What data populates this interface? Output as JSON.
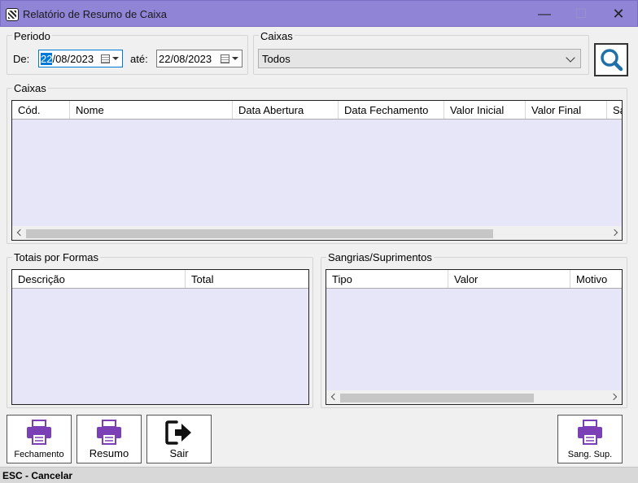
{
  "window": {
    "title": "Relatório de Resumo de Caixa",
    "minimize": "—",
    "maximize": "☐",
    "close": "✕"
  },
  "period": {
    "legend": "Periodo",
    "from_label": "De:",
    "from_value_selected": "22",
    "from_value_rest": "/08/2023",
    "to_label": "até:",
    "to_value": "22/08/2023"
  },
  "caixas_filter": {
    "legend": "Caixas",
    "selected": "Todos"
  },
  "caixas_grid": {
    "legend": "Caixas",
    "columns": [
      "Cód.",
      "Nome",
      "Data Abertura",
      "Data Fechamento",
      "Valor Inicial",
      "Valor Final",
      "Sa"
    ],
    "rows": []
  },
  "totais_grid": {
    "legend": "Totais por Formas",
    "columns": [
      "Descrição",
      "Total"
    ],
    "rows": []
  },
  "sangrias_grid": {
    "legend": "Sangrias/Suprimentos",
    "columns": [
      "Tipo",
      "Valor",
      "Motivo"
    ],
    "rows": []
  },
  "buttons": {
    "fechamento": "Fechamento",
    "resumo": "Resumo",
    "sair": "Sair",
    "sang_sup": "Sang. Sup."
  },
  "status": {
    "text": "ESC - Cancelar"
  },
  "colors": {
    "titlebar": "#8f84d6",
    "grid_bg": "#e6e6f8",
    "printer_purple": "#7b3fb6",
    "search_blue": "#1f6fa8"
  }
}
